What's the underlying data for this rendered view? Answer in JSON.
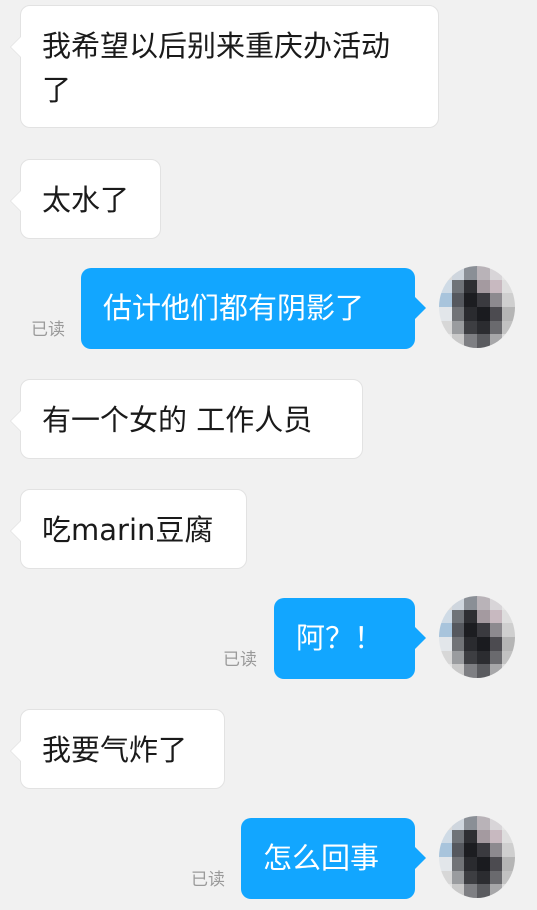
{
  "messages": [
    {
      "side": "in",
      "text": "我希望以后别来重庆办活动了"
    },
    {
      "side": "in",
      "text": "太水了"
    },
    {
      "side": "out",
      "text": "估计他们都有阴影了",
      "status": "已读"
    },
    {
      "side": "in",
      "text": "有一个女的 工作人员"
    },
    {
      "side": "in",
      "text": "吃marin豆腐"
    },
    {
      "side": "out",
      "text": "阿？！",
      "status": "已读"
    },
    {
      "side": "in",
      "text": "我要气炸了"
    },
    {
      "side": "out",
      "text": "怎么回事",
      "status": "已读"
    }
  ],
  "colors": {
    "background": "#f1f1f1",
    "incoming_bubble": "#ffffff",
    "outgoing_bubble": "#12a6ff",
    "status_text": "#9a9a9a"
  },
  "avatar": {
    "icon": "user-avatar-pixelated"
  }
}
